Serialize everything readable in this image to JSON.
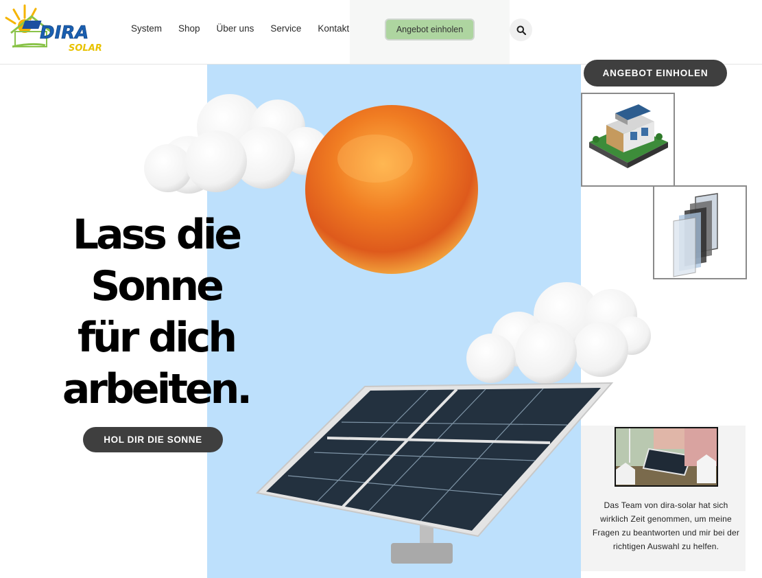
{
  "header": {
    "logo_text_main": "DIRA",
    "logo_text_sub": "SOLAR",
    "nav": [
      {
        "label": "System"
      },
      {
        "label": "Shop"
      },
      {
        "label": "Über uns"
      },
      {
        "label": "Service"
      },
      {
        "label": "Kontakt"
      }
    ],
    "cta_label": "Angebot einholen",
    "search_icon": "search-icon"
  },
  "hero": {
    "title_lines": [
      "Lass die",
      "Sonne",
      "für dich",
      "arbeiten."
    ],
    "cta_label": "HOL DIR DIE SONNE"
  },
  "sidebar": {
    "cta_label": "ANGEBOT EINHOLEN",
    "thumbnails": [
      {
        "icon": "house-icon"
      },
      {
        "icon": "solar-module-layers-icon"
      }
    ]
  },
  "testimonial": {
    "text": "Das Team von dira-solar hat sich wirklich Zeit genommen, um meine Fragen zu beantworten und mir bei der richtigen Auswahl zu helfen."
  },
  "colors": {
    "blue_panel": "#bde0fc",
    "header_cta": "#aed5a0",
    "dark_button": "#3f3f3f"
  }
}
